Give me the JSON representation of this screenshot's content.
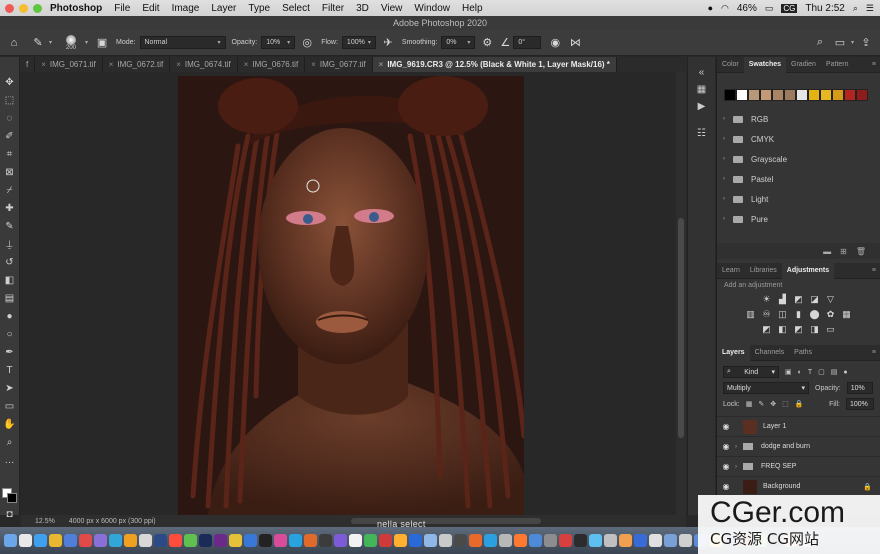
{
  "menubar": {
    "apple": "",
    "items": [
      "Photoshop",
      "File",
      "Edit",
      "Image",
      "Layer",
      "Type",
      "Select",
      "Filter",
      "3D",
      "View",
      "Window",
      "Help"
    ],
    "battery": "46%",
    "input_source": "CG",
    "day_time": "Thu 2:52"
  },
  "window_title": "Adobe Photoshop 2020",
  "options_bar": {
    "brush_size": "200",
    "mode_label": "Mode:",
    "mode_value": "Normal",
    "opacity_label": "Opacity:",
    "opacity_value": "10%",
    "flow_label": "Flow:",
    "flow_value": "100%",
    "smoothing_label": "Smoothing:",
    "smoothing_value": "0%",
    "angle_value": "0°"
  },
  "tabs": [
    {
      "label": "f",
      "active": false
    },
    {
      "label": "IMG_0671.tif",
      "active": false
    },
    {
      "label": "IMG_0672.tif",
      "active": false
    },
    {
      "label": "IMG_0674.tif",
      "active": false
    },
    {
      "label": "IMG_0676.tif",
      "active": false
    },
    {
      "label": "IMG_0677.tif",
      "active": false
    },
    {
      "label": "IMG_9619.CR3 @ 12.5% (Black & White 1, Layer Mask/16) *",
      "active": true
    }
  ],
  "tab_overflow": "»",
  "status": {
    "zoom": "12.5%",
    "doc_info": "4000 px x 6000 px (300 ppi)"
  },
  "swatches_panel": {
    "tabs": [
      "Color",
      "Swatches",
      "Gradien",
      "Pattern"
    ],
    "active_tab": "Swatches",
    "colors": [
      "#000000",
      "#ffffff",
      "#b79878",
      "#c49a76",
      "#a98566",
      "#9b7a5d",
      "#e6e6e6",
      "#e2b312",
      "#e7b623",
      "#d59b18",
      "#b32620",
      "#8d1c1a"
    ],
    "groups": [
      "RGB",
      "CMYK",
      "Grayscale",
      "Pastel",
      "Light",
      "Pure"
    ]
  },
  "adjustments_panel": {
    "tabs": [
      "Learn",
      "Libraries",
      "Adjustments"
    ],
    "active_tab": "Adjustments",
    "hint": "Add an adjustment"
  },
  "layers_panel": {
    "tabs": [
      "Layers",
      "Channels",
      "Paths"
    ],
    "active_tab": "Layers",
    "filter_kind": "Kind",
    "blend_mode": "Multiply",
    "opacity_label": "Opacity:",
    "opacity_value": "10%",
    "lock_label": "Lock:",
    "fill_label": "Fill:",
    "fill_value": "100%",
    "layers": [
      {
        "name": "Layer 1",
        "type": "pixel"
      },
      {
        "name": "dodge and burn",
        "type": "group"
      },
      {
        "name": "FREQ SEP",
        "type": "group"
      },
      {
        "name": "Background",
        "type": "pixel"
      }
    ]
  },
  "dock_label": "nella select",
  "watermark": {
    "line1": "CGer.com",
    "line2": "CG资源 CG网站"
  }
}
